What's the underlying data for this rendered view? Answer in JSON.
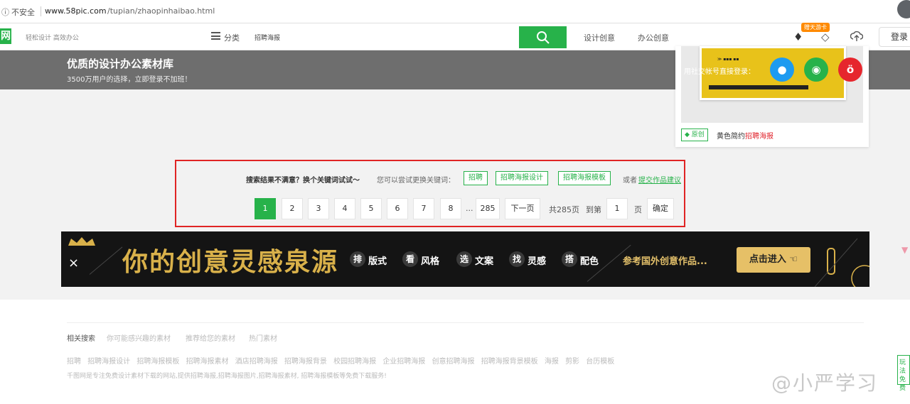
{
  "browser": {
    "info_icon": "ⓘ",
    "security_label": "不安全",
    "url_host": "www.58pic.com",
    "url_path": "/tupian/zhaopinhaibao.html"
  },
  "header": {
    "logo_text": "网",
    "tagline": "轻松设计 高效办公",
    "category_label": "分类",
    "search_value": "招聘海报",
    "nav": [
      "设计创意",
      "办公创意"
    ],
    "vip_badge": "赠天游卡",
    "login_label": "登录",
    "icons": [
      "menu-icon",
      "search-icon",
      "diamond-icon",
      "vip-diamond-icon",
      "upload-icon"
    ]
  },
  "promo": {
    "title": "优质的设计办公素材库",
    "subtitle": "3500万用户的选择，立即登录不加班！",
    "social_label": "用社交帐号直接登录：",
    "social": [
      "qq-icon",
      "wechat-icon",
      "weibo-icon"
    ]
  },
  "result_card": {
    "badge": "原创",
    "title_prefix": "黄色简约",
    "title_highlight": "招聘海报"
  },
  "search_suggest": {
    "hint_main": "搜索结果不满意？换个关键词试试～",
    "hint_sub": "您可以尝试更换关键词：",
    "keywords": [
      "招聘",
      "招聘海报设计",
      "招聘海报模板"
    ],
    "or_label": "或者",
    "suggest_link": "提交作品建议"
  },
  "pagination": {
    "pages": [
      "1",
      "2",
      "3",
      "4",
      "5",
      "6",
      "7",
      "8"
    ],
    "current": "1",
    "ellipsis": "...",
    "last": "285",
    "next_label": "下一页",
    "total_label": "共285页",
    "goto_label": "到第",
    "goto_value": "1",
    "page_unit": "页",
    "confirm_label": "确定"
  },
  "banner": {
    "main": "你的创意灵感泉源",
    "tags": [
      {
        "badge": "排",
        "word": "版式"
      },
      {
        "badge": "看",
        "word": "风格"
      },
      {
        "badge": "选",
        "word": "文案"
      },
      {
        "badge": "找",
        "word": "灵感"
      },
      {
        "badge": "搭",
        "word": "配色"
      }
    ],
    "reference": "参考国外创意作品...",
    "cta": "点击进入",
    "colors": {
      "gold": "#d9b14a",
      "background": "#141414"
    }
  },
  "footer": {
    "related_tabs": [
      "相关搜索",
      "你可能感兴趣的素材",
      "推荐给您的素材",
      "热门素材"
    ],
    "tags": [
      "招聘",
      "招聘海报设计",
      "招聘海报模板",
      "招聘海报素材",
      "酒店招聘海报",
      "招聘海报背景",
      "校园招聘海报",
      "企业招聘海报",
      "创意招聘海报",
      "招聘海报背景模板",
      "海报",
      "剪影",
      "台历模板"
    ],
    "description": "千图网是专注免费设计素材下载的网站,提供招聘海报,招聘海报图片,招聘海报素材, 招聘海报模板等免费下载服务!",
    "watermark": "@小严学习",
    "side_tab": "玩法免费"
  },
  "colors": {
    "accent": "#27b24a",
    "highlight": "#e02424"
  }
}
